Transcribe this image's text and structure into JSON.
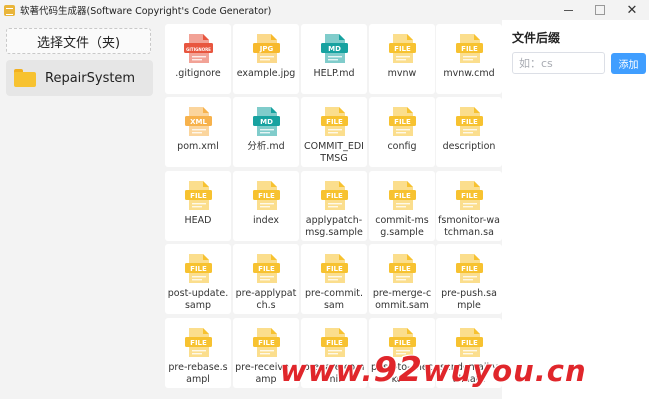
{
  "window": {
    "title": "软著代码生成器(Software Copyright's Code Generator)",
    "minimize": "–",
    "maximize": "□",
    "close": "✕"
  },
  "sidebar": {
    "select_folder_label": "选择文件（夹)",
    "projects": [
      {
        "label": "RepairSystem",
        "icon": "folder-icon"
      }
    ]
  },
  "files": [
    {
      "name": ".gitignore",
      "type": "GITIGNORE",
      "color": "#e8563f"
    },
    {
      "name": "example.jpg",
      "type": "JPG",
      "color": "#f7b92c"
    },
    {
      "name": "HELP.md",
      "type": "MD",
      "color": "#17a2a0"
    },
    {
      "name": "mvnw",
      "type": "FILE",
      "color": "#f7c230"
    },
    {
      "name": "mvnw.cmd",
      "type": "FILE",
      "color": "#f7c230"
    },
    {
      "name": "pom.xml",
      "type": "XML",
      "color": "#f7b24c"
    },
    {
      "name": "分析.md",
      "type": "MD",
      "color": "#17a2a0"
    },
    {
      "name": "COMMIT_EDITMSG",
      "type": "FILE",
      "color": "#f7c230"
    },
    {
      "name": "config",
      "type": "FILE",
      "color": "#f7c230"
    },
    {
      "name": "description",
      "type": "FILE",
      "color": "#f7c230"
    },
    {
      "name": "HEAD",
      "type": "FILE",
      "color": "#f7c230"
    },
    {
      "name": "index",
      "type": "FILE",
      "color": "#f7c230"
    },
    {
      "name": "applypatch-msg.sample",
      "type": "FILE",
      "color": "#f7c230"
    },
    {
      "name": "commit-msg.sample",
      "type": "FILE",
      "color": "#f7c230"
    },
    {
      "name": "fsmonitor-watchman.sa",
      "type": "FILE",
      "color": "#f7c230"
    },
    {
      "name": "post-update.samp",
      "type": "FILE",
      "color": "#f7c230"
    },
    {
      "name": "pre-applypatch.s",
      "type": "FILE",
      "color": "#f7c230"
    },
    {
      "name": "pre-commit.sam",
      "type": "FILE",
      "color": "#f7c230"
    },
    {
      "name": "pre-merge-commit.sam",
      "type": "FILE",
      "color": "#f7c230"
    },
    {
      "name": "pre-push.sample",
      "type": "FILE",
      "color": "#f7c230"
    },
    {
      "name": "pre-rebase.sampl",
      "type": "FILE",
      "color": "#f7c230"
    },
    {
      "name": "pre-receive.samp",
      "type": "FILE",
      "color": "#f7c230"
    },
    {
      "name": "prepare-commit",
      "type": "FILE",
      "color": "#f7c230"
    },
    {
      "name": "push-to-checkout",
      "type": "FILE",
      "color": "#f7c230"
    },
    {
      "name": "sendemail-validate",
      "type": "FILE",
      "color": "#f7c230"
    }
  ],
  "suffix_panel": {
    "title": "文件后缀",
    "input_placeholder": "如：cs",
    "input_value": "",
    "add_label": "添加"
  },
  "watermark": {
    "www": "www.",
    "num": "92",
    "rest": "wuyou.cn"
  }
}
